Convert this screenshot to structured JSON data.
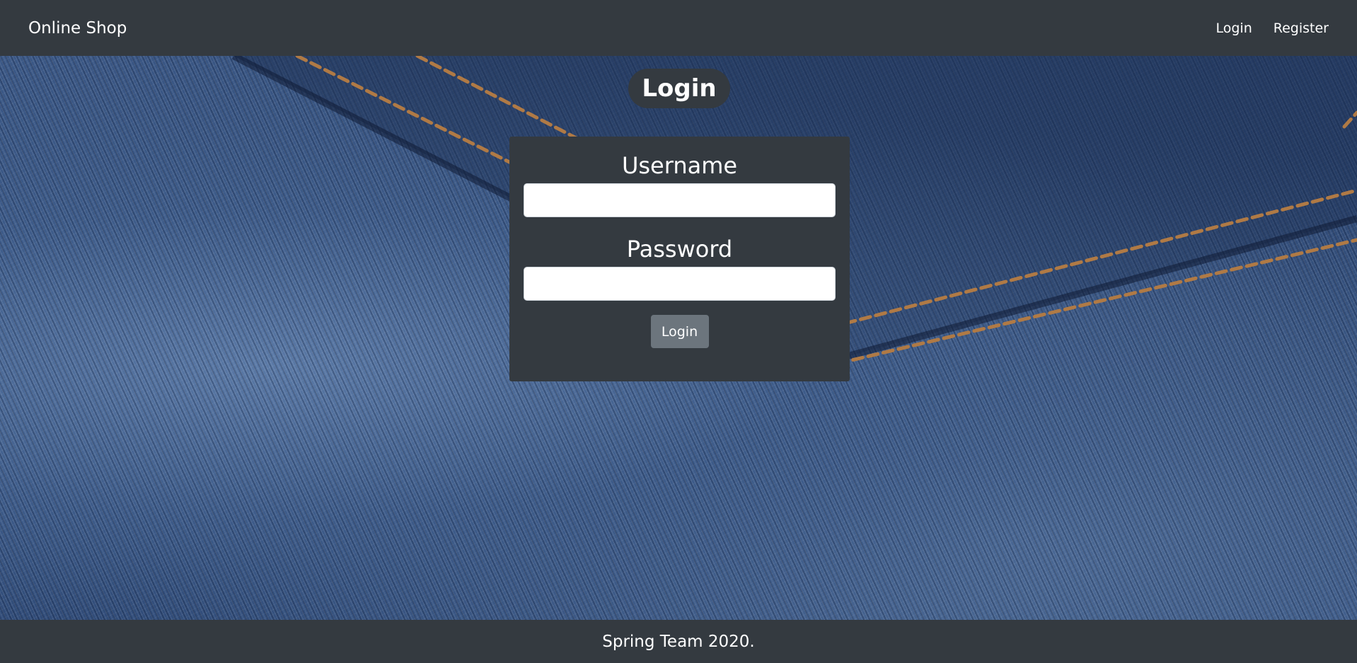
{
  "navbar": {
    "brand": "Online Shop",
    "links": [
      {
        "label": "Login"
      },
      {
        "label": "Register"
      }
    ]
  },
  "login_form": {
    "title": "Login",
    "username_label": "Username",
    "username_value": "",
    "password_label": "Password",
    "password_value": "",
    "submit_label": "Login"
  },
  "footer": {
    "text": "Spring Team 2020."
  },
  "background": {
    "image": "denim-jeans-pocket",
    "stitch_color": "#b07a45"
  },
  "colors": {
    "dark": "#343a40",
    "button": "#6c757d",
    "text": "#ffffff"
  }
}
